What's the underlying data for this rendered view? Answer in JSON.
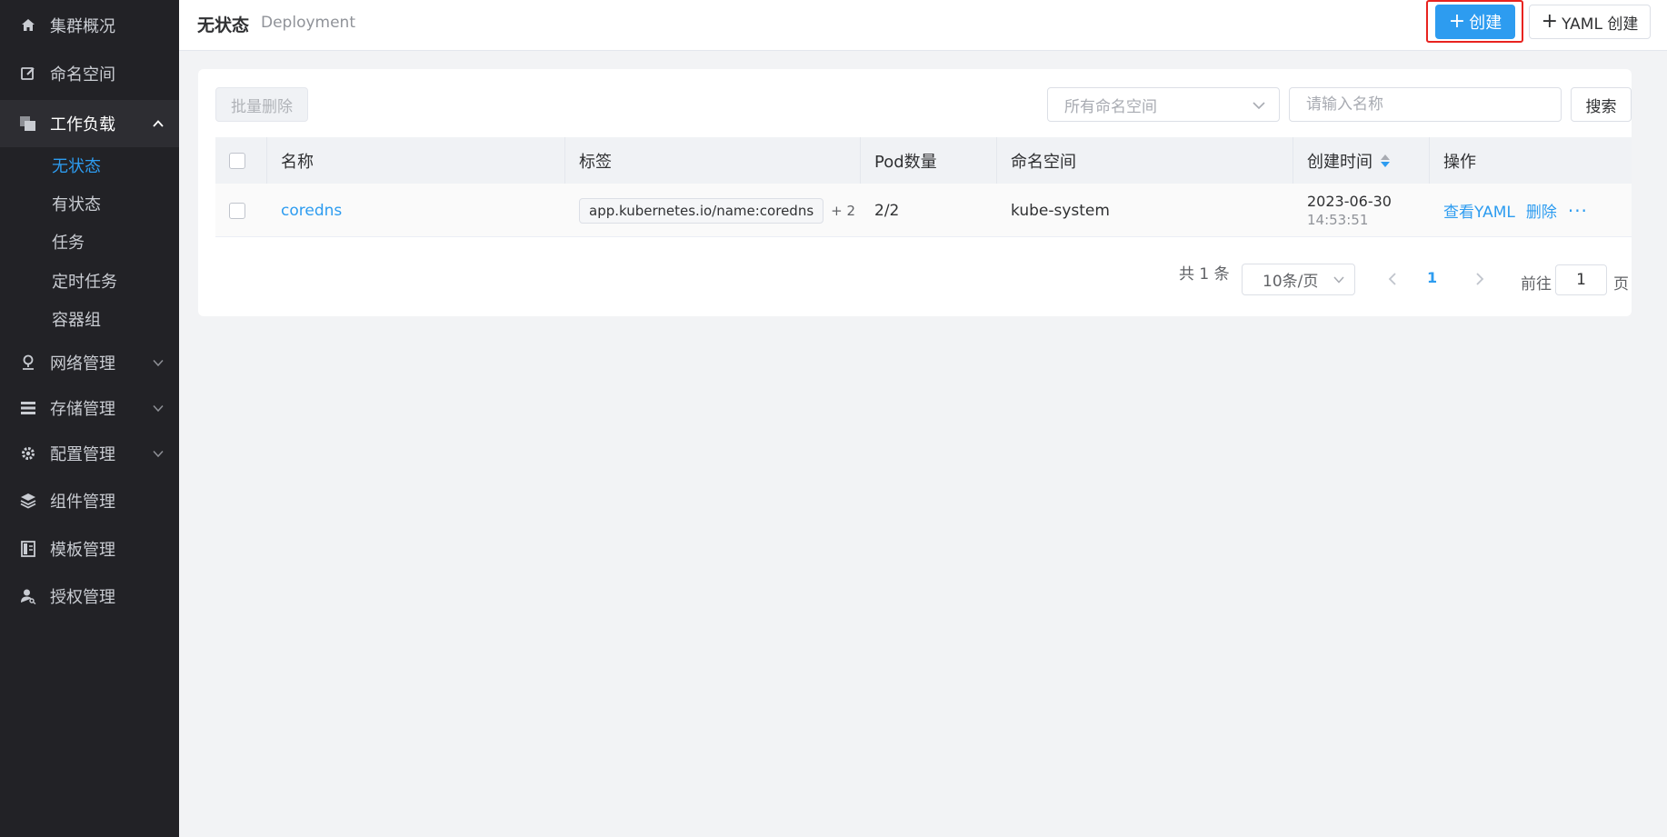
{
  "sidebar": {
    "items": [
      {
        "label": "集群概况",
        "icon": "home-icon"
      },
      {
        "label": "命名空间",
        "icon": "edit-icon"
      },
      {
        "label": "工作负载",
        "icon": "layers-icon",
        "expanded": true
      },
      {
        "label": "网络管理",
        "icon": "network-icon"
      },
      {
        "label": "存储管理",
        "icon": "storage-icon"
      },
      {
        "label": "配置管理",
        "icon": "gear-icon"
      },
      {
        "label": "组件管理",
        "icon": "stack-icon"
      },
      {
        "label": "模板管理",
        "icon": "template-icon"
      },
      {
        "label": "授权管理",
        "icon": "user-key-icon"
      }
    ],
    "workload_sub": [
      {
        "label": "无状态",
        "active": true
      },
      {
        "label": "有状态"
      },
      {
        "label": "任务"
      },
      {
        "label": "定时任务"
      },
      {
        "label": "容器组"
      }
    ]
  },
  "header": {
    "title": "无状态",
    "subtitle": "Deployment",
    "create_label": "创建",
    "yaml_create_label": "YAML 创建"
  },
  "toolbar": {
    "batch_delete_label": "批量删除",
    "namespace_placeholder": "所有命名空间",
    "name_placeholder": "请输入名称",
    "search_label": "搜索"
  },
  "table": {
    "columns": [
      "名称",
      "标签",
      "Pod数量",
      "命名空间",
      "创建时间",
      "操作"
    ],
    "rows": [
      {
        "name": "coredns",
        "label": "app.kubernetes.io/name:coredns",
        "label_more": "+ 2",
        "pods": "2/2",
        "namespace": "kube-system",
        "date": "2023-06-30",
        "time": "14:53:51",
        "action_view": "查看YAML",
        "action_delete": "删除",
        "action_more": "···"
      }
    ]
  },
  "pagination": {
    "total_text": "共 1 条",
    "page_size": "10条/页",
    "current_page": "1",
    "goto_label": "前往",
    "goto_value": "1",
    "page_suffix": "页"
  },
  "colors": {
    "accent": "#2d9cf0",
    "sidebar_bg": "#222226",
    "highlight_outline": "#e8231f"
  }
}
